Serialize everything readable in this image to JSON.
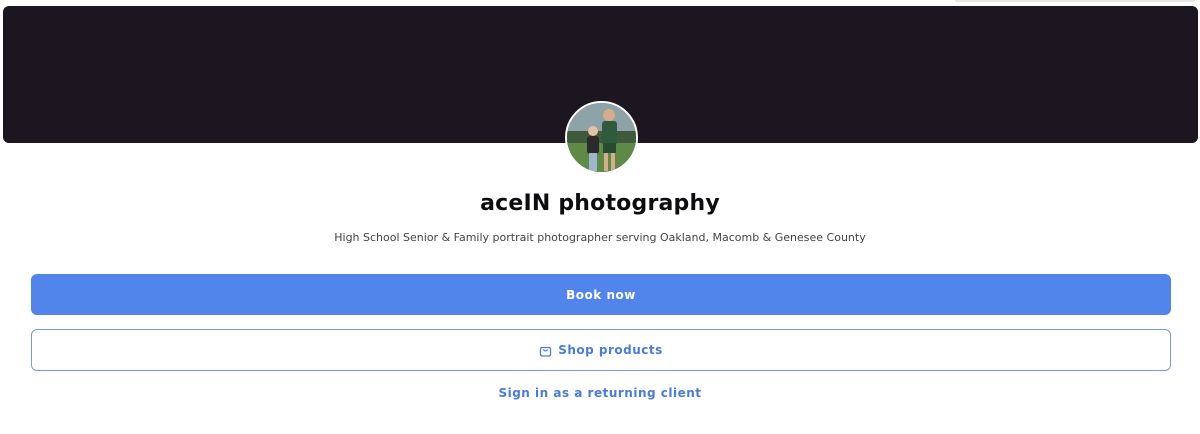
{
  "profile": {
    "name": "aceIN photography",
    "tagline": "High School Senior & Family portrait photographer serving Oakland, Macomb & Genesee County"
  },
  "actions": {
    "book_label": "Book now",
    "shop_label": "Shop products",
    "signin_label": "Sign in as a returning client"
  },
  "icons": {
    "shop": "shopping-bag-icon"
  },
  "colors": {
    "cover": "#1b1620",
    "primary": "#5285ec",
    "link": "#4a7be0"
  }
}
